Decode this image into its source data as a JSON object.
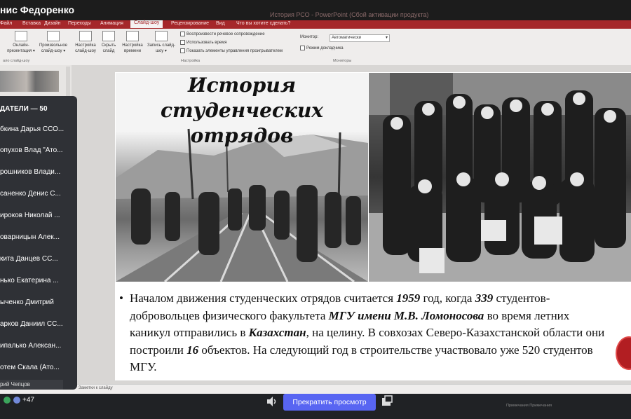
{
  "window": {
    "presenter_name": "нис Федоренко",
    "title": "История РСО - PowerPoint (Сбой активации продукта)"
  },
  "ribbon_tabs": [
    "Файл",
    "Вставка",
    "Дизайн",
    "Переходы",
    "Анимация",
    "Слайд-шоу",
    "Рецензирование",
    "Вид",
    "Что вы хотите сделать?"
  ],
  "ribbon_active_tab": "Слайд-шоу",
  "ribbon": {
    "buttons": [
      {
        "label": "Онлайн-\nпрезентация ▾"
      },
      {
        "label": "Произвольное\nслайд-шоу ▾"
      },
      {
        "label": "Настройка\nслайд-шоу"
      },
      {
        "label": "Скрыть\nслайд"
      },
      {
        "label": "Настройка\nвремени"
      },
      {
        "label": "Запись слайд-\nшоу ▾"
      }
    ],
    "checkboxes": [
      {
        "label": "Воспроизвести речевое сопровождение",
        "checked": true
      },
      {
        "label": "Использовать время",
        "checked": true
      },
      {
        "label": "Показать элементы управления проигрывателем",
        "checked": true
      }
    ],
    "monitor_label": "Монитор:",
    "monitor_value": "Автоматически",
    "presenter_view_label": "Режим докладчика",
    "groups": [
      "ало слайд-шоу",
      "Настройка",
      "Мониторы"
    ]
  },
  "participants": {
    "header": "ДАТЕЛИ — 50",
    "rows": [
      "бкина Дарья ССО...",
      "опухов Влад \"Ато...",
      "рошников Влади...",
      "саненко Денис С...",
      "ироков Николай ...",
      "оварницын Алек...",
      "кита Данцев СС...",
      "нько Екатерина ...",
      "ыченко Дмитрий",
      "арков Даниил СС...",
      "ипалько Алексан...",
      "отем Скала (Ато..."
    ],
    "partial": "рий Чепцов"
  },
  "slide": {
    "heading_line1": "История студенческих",
    "heading_line2": "отрядов",
    "text_before": "Началом движения студенческих отрядов считается ",
    "year": "1959",
    "text_mid1": " год, когда ",
    "count": "339",
    "text_mid2": " студентов-добровольцев физического факультета ",
    "university": "МГУ имени М.В. Ломоносова",
    "text_mid3": " во время летних каникул отправились в ",
    "place": "Казахстан",
    "text_mid4": ", на целину. В совхозах Северо-Казахстанской области они построили ",
    "objects": "16",
    "text_end": " объектов. На следующий год в строительстве участвовало уже 520 студентов МГУ."
  },
  "notes_label": "Заметки к слайду",
  "status_right": "Примечания  Примечания",
  "bottom": {
    "others_count": "+47",
    "stop_label": "Прекратить просмотр"
  }
}
